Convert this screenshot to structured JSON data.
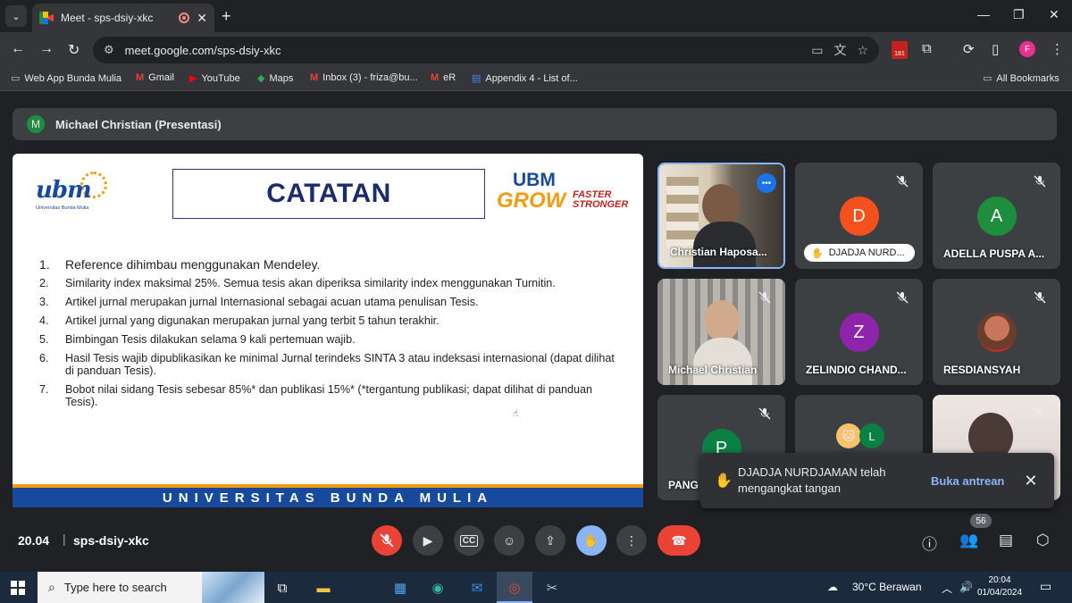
{
  "browser": {
    "tab_title": "Meet - sps-dsiy-xkc",
    "url": "meet.google.com/sps-dsiy-xkc",
    "extension_badge": "181",
    "profile_initial": "F",
    "bookmarks": [
      {
        "label": "Web App Bunda Mulia",
        "icon": "folder-icon"
      },
      {
        "label": "Gmail",
        "icon": "gmail-icon"
      },
      {
        "label": "YouTube",
        "icon": "youtube-icon"
      },
      {
        "label": "Maps",
        "icon": "maps-icon"
      },
      {
        "label": "Inbox (3) - friza@bu...",
        "icon": "gmail-icon"
      },
      {
        "label": "eR",
        "icon": "gmail-icon"
      },
      {
        "label": "Appendix 4 - List of...",
        "icon": "docs-icon"
      }
    ],
    "all_bookmarks": "All Bookmarks"
  },
  "meet": {
    "presenter_initial": "M",
    "presenter_label": "Michael Christian (Presentasi)",
    "slide": {
      "logo_text": "ubm",
      "logo_sub": "Universitas Bunda Mulia",
      "title": "CATATAN",
      "grow_ubm": "UBM",
      "grow_word": "GROW",
      "grow_faster": "FASTER",
      "grow_stronger": "STRONGER",
      "items": [
        {
          "num": "1.",
          "text": "Reference dihimbau menggunakan Mendeley."
        },
        {
          "num": "2.",
          "text": "Similarity index maksimal 25%. Semua tesis akan diperiksa similarity index menggunakan Turnitin."
        },
        {
          "num": "3.",
          "text": "Artikel jurnal merupakan jurnal Internasional sebagai acuan utama penulisan Tesis."
        },
        {
          "num": "4.",
          "text": "Artikel jurnal yang digunakan merupakan jurnal yang terbit 5 tahun terakhir."
        },
        {
          "num": "5.",
          "text": "Bimbingan Tesis dilakukan selama 9 kali pertemuan wajib."
        },
        {
          "num": "6.",
          "text": "Hasil Tesis wajib dipublikasikan ke minimal Jurnal terindeks SINTA 3 atau indeksasi internasional (dapat dilihat di panduan Tesis)."
        },
        {
          "num": "7.",
          "text": "Bobot nilai sidang Tesis sebesar 85%* dan publikasi 15%* (*tergantung publikasi; dapat dilihat di panduan Tesis)."
        }
      ],
      "footer": "UNIVERSITAS BUNDA MULIA"
    },
    "participants": [
      {
        "name": "Christian Haposa...",
        "initial": "",
        "color": "",
        "video": true
      },
      {
        "name": "DJADJA NURD...",
        "initial": "D",
        "color": "#f4511e",
        "hand": true
      },
      {
        "name": "ADELLA PUSPA A...",
        "initial": "A",
        "color": "#1e8e3e"
      },
      {
        "name": "Michael Christian",
        "initial": "",
        "color": "",
        "video": true
      },
      {
        "name": "ZELINDIO CHAND...",
        "initial": "Z",
        "color": "#8e24aa"
      },
      {
        "name": "RESDIANSYAH",
        "initial": "",
        "color": "",
        "photo": true
      },
      {
        "name": "PANG",
        "initial": "P",
        "color": "#0b8043"
      },
      {
        "name": "",
        "initial": "L",
        "color": "#0b8043"
      },
      {
        "name": "",
        "initial": "",
        "color": "",
        "video": true
      }
    ],
    "toast": {
      "message": "DJADJA NURDJAMAN telah mengangkat tangan",
      "action": "Buka antrean"
    },
    "time": "20.04",
    "separator": "|",
    "code": "sps-dsiy-xkc",
    "people_count": "56"
  },
  "taskbar": {
    "search_placeholder": "Type here to search",
    "weather": "30°C  Berawan",
    "time": "20:04",
    "date": "01/04/2024"
  },
  "colors": {
    "meet_bg": "#202124",
    "tile_bg": "#3c4043",
    "mic_off_red": "#ea4335",
    "raise_hand_blue": "#8ab4f8",
    "slide_blue": "#174a9c",
    "slide_orange": "#f39c12"
  }
}
